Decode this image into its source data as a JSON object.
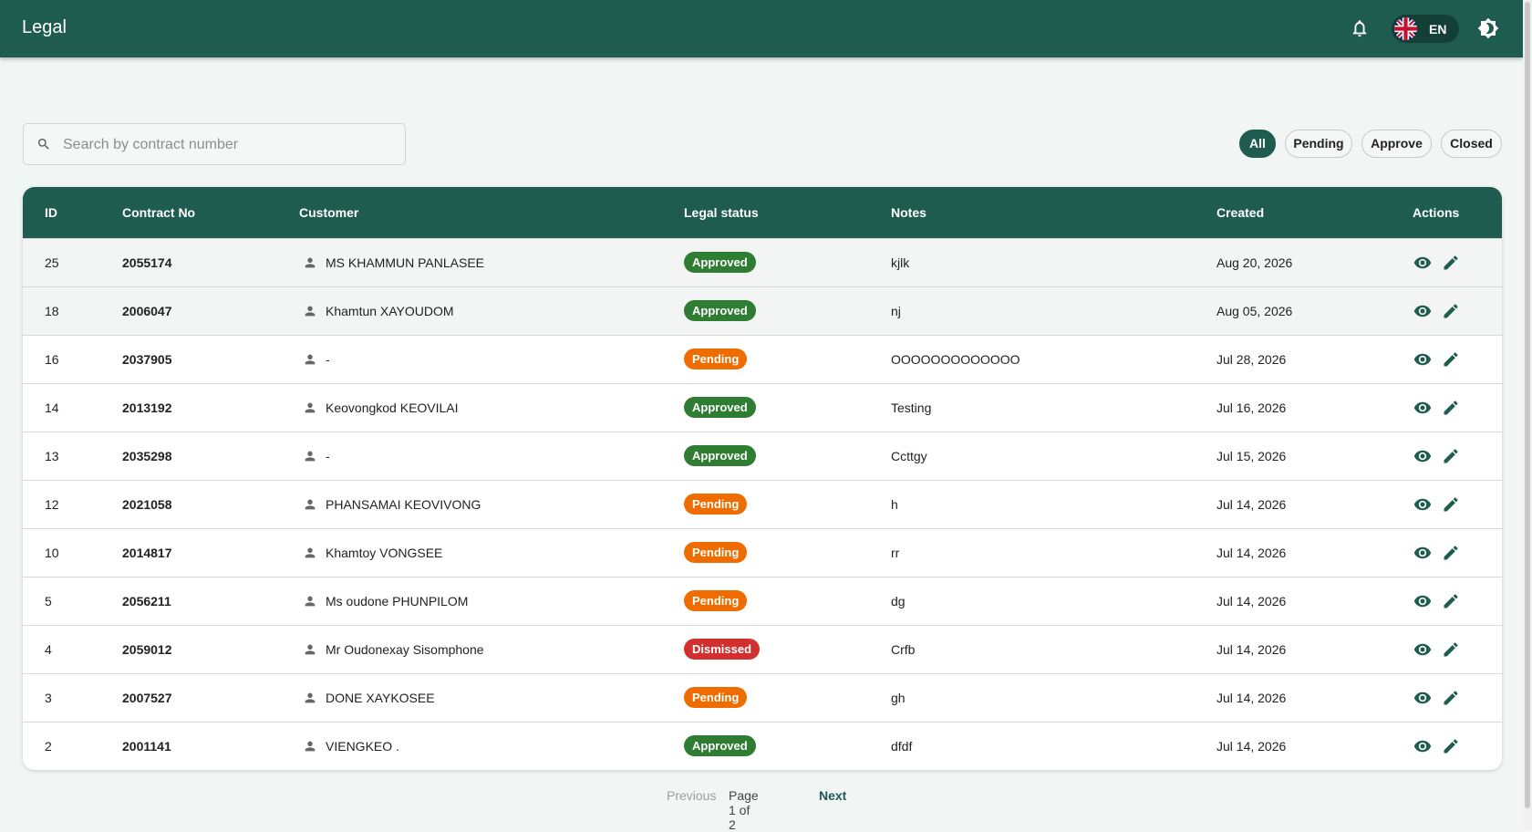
{
  "app": {
    "title": "Legal"
  },
  "header": {
    "language_code": "EN"
  },
  "search": {
    "placeholder": "Search by contract number",
    "value": ""
  },
  "filters": [
    {
      "label": "All",
      "active": true
    },
    {
      "label": "Pending",
      "active": false
    },
    {
      "label": "Approve",
      "active": false
    },
    {
      "label": "Closed",
      "active": false
    }
  ],
  "table": {
    "columns": [
      "ID",
      "Contract No",
      "Customer",
      "Legal status",
      "Notes",
      "Created",
      "Actions"
    ],
    "rows": [
      {
        "id": "25",
        "contract": "2055174",
        "customer": "MS KHAMMUN PANLASEE",
        "status": "Approved",
        "notes": "kjlk",
        "created": "Aug 20, 2026"
      },
      {
        "id": "18",
        "contract": "2006047",
        "customer": "Khamtun XAYOUDOM",
        "status": "Approved",
        "notes": "nj",
        "created": "Aug 05, 2026"
      },
      {
        "id": "16",
        "contract": "2037905",
        "customer": "-",
        "status": "Pending",
        "notes": "OOOOOOOOOOOOO",
        "created": "Jul 28, 2026"
      },
      {
        "id": "14",
        "contract": "2013192",
        "customer": "Keovongkod KEOVILAI",
        "status": "Approved",
        "notes": "Testing",
        "created": "Jul 16, 2026"
      },
      {
        "id": "13",
        "contract": "2035298",
        "customer": "-",
        "status": "Approved",
        "notes": "Ccttgy",
        "created": "Jul 15, 2026"
      },
      {
        "id": "12",
        "contract": "2021058",
        "customer": "PHANSAMAI KEOVIVONG",
        "status": "Pending",
        "notes": "h",
        "created": "Jul 14, 2026"
      },
      {
        "id": "10",
        "contract": "2014817",
        "customer": "Khamtoy VONGSEE",
        "status": "Pending",
        "notes": "rr",
        "created": "Jul 14, 2026"
      },
      {
        "id": "5",
        "contract": "2056211",
        "customer": "Ms oudone PHUNPILOM",
        "status": "Pending",
        "notes": "dg",
        "created": "Jul 14, 2026"
      },
      {
        "id": "4",
        "contract": "2059012",
        "customer": "Mr Oudonexay Sisomphone",
        "status": "Dismissed",
        "notes": "Crfb",
        "created": "Jul 14, 2026"
      },
      {
        "id": "3",
        "contract": "2007527",
        "customer": "DONE XAYKOSEE",
        "status": "Pending",
        "notes": "gh",
        "created": "Jul 14, 2026"
      },
      {
        "id": "2",
        "contract": "2001141",
        "customer": "VIENGKEO .",
        "status": "Approved",
        "notes": "dfdf",
        "created": "Jul 14, 2026"
      }
    ]
  },
  "pagination": {
    "previous": "Previous",
    "page_text": "Page 1 of 2",
    "next": "Next"
  },
  "icons": {
    "notifications": "bell-icon",
    "language_flag": "uk-flag-icon",
    "theme": "brightness-icon",
    "search": "search-icon",
    "customer": "person-icon",
    "view": "eye-icon",
    "edit": "pencil-icon"
  },
  "colors": {
    "primary": "#1e5c50",
    "approved": "#2e7d32",
    "pending": "#ef6c00",
    "dismissed": "#d32f2f",
    "background": "#f1f5f3"
  }
}
